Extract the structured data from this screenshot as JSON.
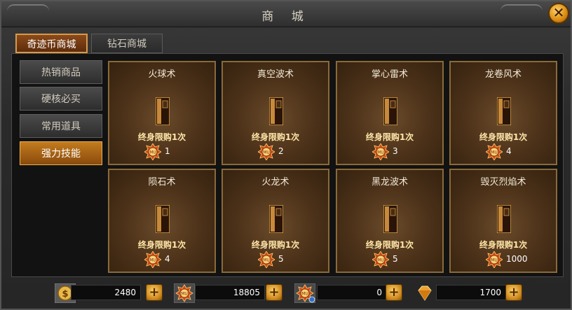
{
  "window": {
    "title": "商 城"
  },
  "tabs": [
    {
      "label": "奇迹币商城",
      "active": true
    },
    {
      "label": "钻石商城",
      "active": false
    }
  ],
  "sidebar": [
    {
      "label": "热销商品",
      "active": false
    },
    {
      "label": "硬核必买",
      "active": false
    },
    {
      "label": "常用道具",
      "active": false
    },
    {
      "label": "强力技能",
      "active": true
    }
  ],
  "items": [
    {
      "name": "火球术",
      "limit": "终身限购1次",
      "price": "1"
    },
    {
      "name": "真空波术",
      "limit": "终身限购1次",
      "price": "2"
    },
    {
      "name": "掌心雷术",
      "limit": "终身限购1次",
      "price": "3"
    },
    {
      "name": "龙卷风术",
      "limit": "终身限购1次",
      "price": "4"
    },
    {
      "name": "陨石术",
      "limit": "终身限购1次",
      "price": "4"
    },
    {
      "name": "火龙术",
      "limit": "终身限购1次",
      "price": "5"
    },
    {
      "name": "黑龙波术",
      "limit": "终身限购1次",
      "price": "5"
    },
    {
      "name": "毁灭烈焰术",
      "limit": "终身限购1次",
      "price": "1000"
    }
  ],
  "currencies": [
    {
      "icon": "gold-coin-icon",
      "value": "2480"
    },
    {
      "icon": "medal-icon",
      "value": "18805"
    },
    {
      "icon": "bound-medal-icon",
      "value": "0"
    },
    {
      "icon": "diamond-icon",
      "value": "1700"
    }
  ],
  "colors": {
    "accent": "#c27b1e",
    "limit_text": "#ffe7a8",
    "border_gold": "#8a6a3a"
  }
}
